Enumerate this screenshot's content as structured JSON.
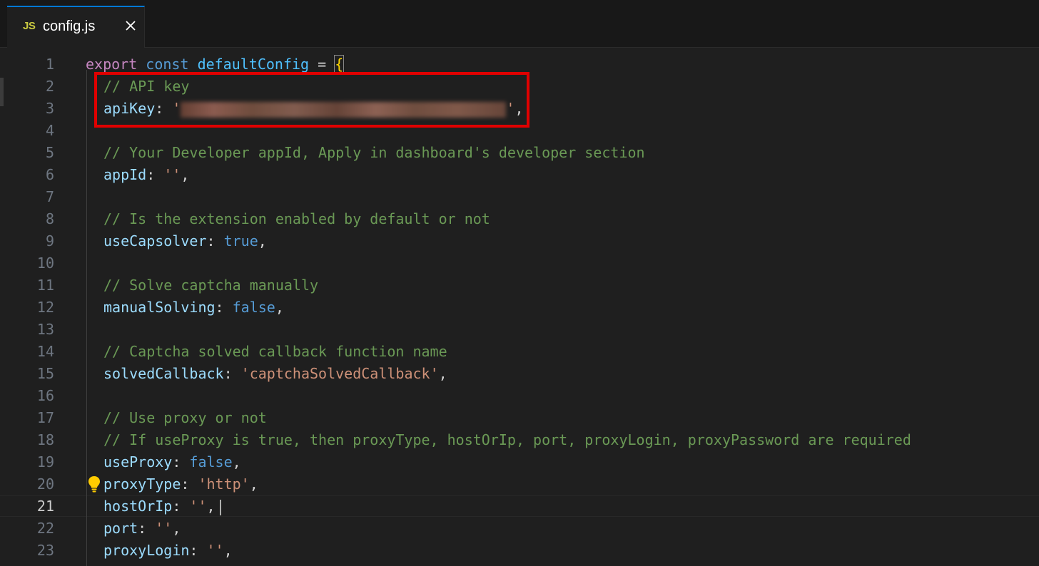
{
  "tab": {
    "icon": "JS",
    "filename": "config.js",
    "close_icon": "close-icon"
  },
  "editor": {
    "active_line": "21",
    "line_numbers": [
      "1",
      "2",
      "3",
      "4",
      "5",
      "6",
      "7",
      "8",
      "9",
      "10",
      "11",
      "12",
      "13",
      "14",
      "15",
      "16",
      "17",
      "18",
      "19",
      "20",
      "21",
      "22",
      "23"
    ],
    "lines": {
      "l1": {
        "export": "export",
        "const": "const",
        "name": "defaultConfig",
        "eq": " = ",
        "brace": "{"
      },
      "l2": {
        "comment": "// API key"
      },
      "l3": {
        "key": "apiKey",
        "colon": ": ",
        "q1": "'",
        "q2": "'",
        "comma": ","
      },
      "l5": {
        "comment": "// Your Developer appId, Apply in dashboard's developer section"
      },
      "l6": {
        "key": "appId",
        "colon": ": ",
        "value": "''",
        "comma": ","
      },
      "l8": {
        "comment": "// Is the extension enabled by default or not"
      },
      "l9": {
        "key": "useCapsolver",
        "colon": ": ",
        "value": "true",
        "comma": ","
      },
      "l11": {
        "comment": "// Solve captcha manually"
      },
      "l12": {
        "key": "manualSolving",
        "colon": ": ",
        "value": "false",
        "comma": ","
      },
      "l14": {
        "comment": "// Captcha solved callback function name"
      },
      "l15": {
        "key": "solvedCallback",
        "colon": ": ",
        "value": "'captchaSolvedCallback'",
        "comma": ","
      },
      "l17": {
        "comment": "// Use proxy or not"
      },
      "l18": {
        "comment": "// If useProxy is true, then proxyType, hostOrIp, port, proxyLogin, proxyPassword are required"
      },
      "l19": {
        "key": "useProxy",
        "colon": ": ",
        "value": "false",
        "comma": ","
      },
      "l20": {
        "key": "proxyType",
        "colon": ": ",
        "value": "'http'",
        "comma": ","
      },
      "l21": {
        "key": "hostOrIp",
        "colon": ": ",
        "value": "''",
        "comma": ","
      },
      "l22": {
        "key": "port",
        "colon": ": ",
        "value": "''",
        "comma": ","
      },
      "l23": {
        "key": "proxyLogin",
        "colon": ": ",
        "value": "''",
        "comma": ","
      }
    }
  },
  "colors": {
    "highlight_box": "#e00000",
    "comment": "#6a9955",
    "string": "#ce9178",
    "keyword": "#569cd6"
  }
}
